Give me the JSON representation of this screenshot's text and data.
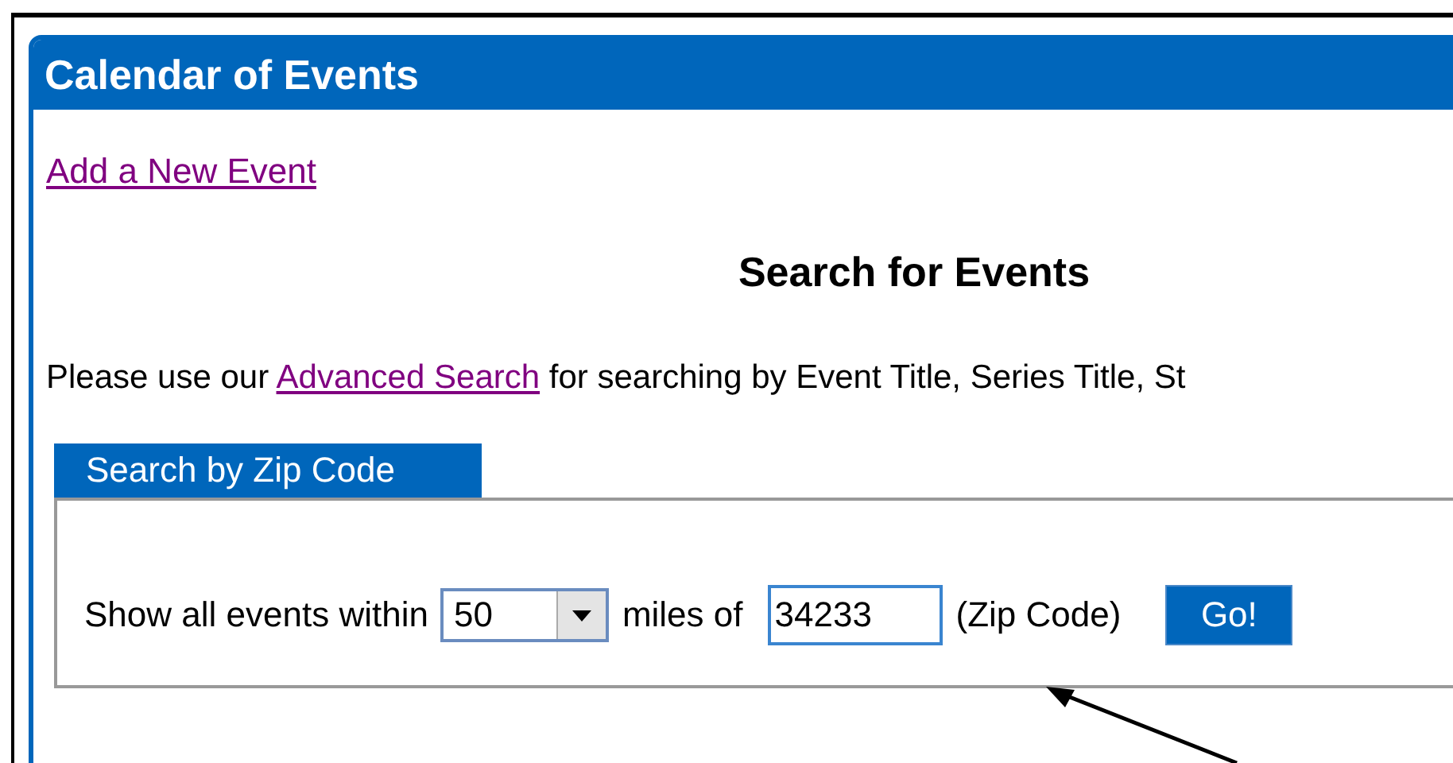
{
  "panel": {
    "title": "Calendar of Events"
  },
  "add_link": "Add a New Event",
  "heading": "Search for Events",
  "intro": {
    "before": "Please use our ",
    "link": "Advanced Search",
    "after": " for searching by Event Title, Series Title, St"
  },
  "zip_search": {
    "tab": "Search by Zip Code",
    "label_before": "Show all events within",
    "distance": {
      "value": "50"
    },
    "label_middle": "miles of",
    "zip": {
      "value": "34233"
    },
    "label_after": "(Zip Code)",
    "button": "Go!"
  }
}
